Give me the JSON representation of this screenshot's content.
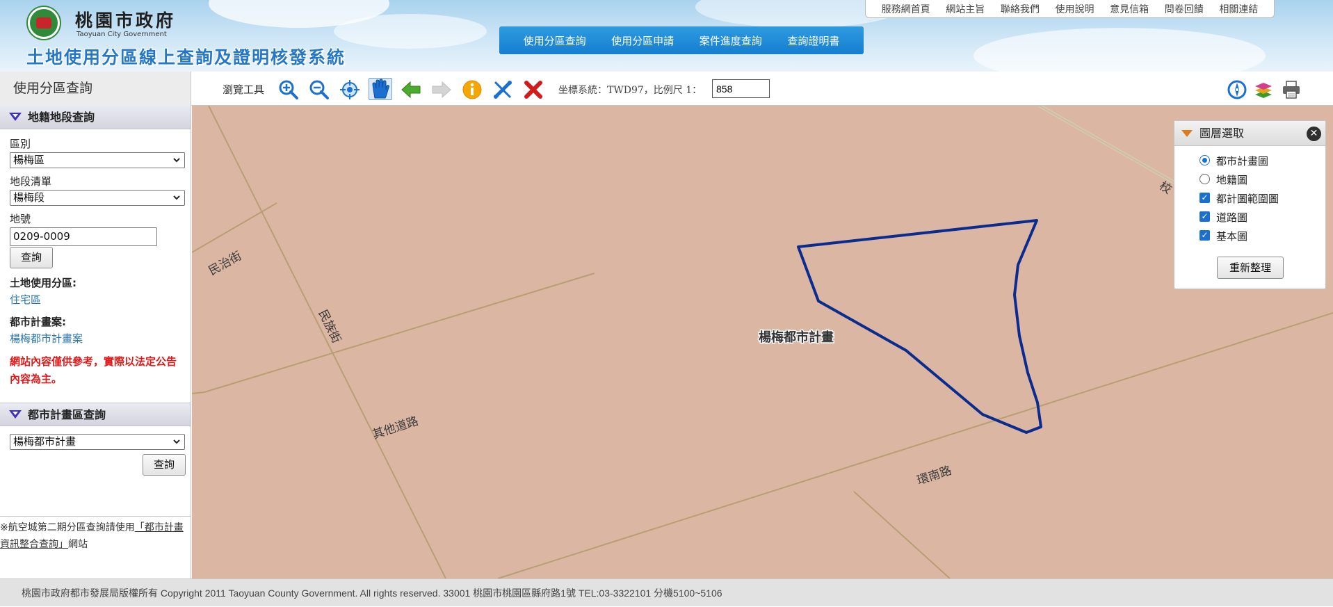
{
  "header": {
    "org_name": "桃園市政府",
    "org_name_en": "Taoyuan City Government",
    "system_title": "土地使用分區線上查詢及證明核發系統",
    "top_links": [
      "服務網首頁",
      "網站主旨",
      "聯絡我們",
      "使用說明",
      "意見信箱",
      "問卷回饋",
      "相關連結"
    ],
    "main_nav": [
      "使用分區查詢",
      "使用分區申請",
      "案件進度查詢",
      "查詢證明書"
    ]
  },
  "toolbar": {
    "panel_title": "使用分區查詢",
    "browse_label": "瀏覽工具",
    "tools": [
      "zoom-in-icon",
      "zoom-out-icon",
      "full-extent-icon",
      "pan-hand-icon",
      "previous-extent-icon",
      "next-extent-icon",
      "identify-info-icon",
      "measure-icon",
      "clear-icon"
    ],
    "coord_label": "坐標系統：TWD97，比例尺 1：",
    "scale_value": "858",
    "right_tools": [
      "compass-icon",
      "layers-icon",
      "print-icon"
    ]
  },
  "cadastral_query": {
    "section_title": "地籍地段查詢",
    "district_label": "區別",
    "district_value": "楊梅區",
    "section_list_label": "地段清單",
    "section_list_value": "楊梅段",
    "lot_label": "地號",
    "lot_value": "0209-0009",
    "query_button": "查詢",
    "zoning_label": "土地使用分區:",
    "zoning_value": "住宅區",
    "plan_label": "都市計畫案:",
    "plan_value": "楊梅都市計畫案",
    "disclaimer": "網站內容僅供參考，實際以法定公告內容為主。"
  },
  "urban_plan_query": {
    "section_title": "都市計畫區查詢",
    "plan_value": "楊梅都市計畫",
    "query_button": "查詢"
  },
  "aerotropolis_note": {
    "prefix": "※航空城第二期分區查詢請使用",
    "link": "「都市計畫資訊整合查詢」",
    "suffix": "網站"
  },
  "map": {
    "street_labels": [
      "民治街",
      "民族街",
      "其他道路",
      "環南路",
      "校"
    ],
    "plan_area_label": "楊梅都市計畫",
    "colors": {
      "background": "#dbb7a3",
      "road": "#b79f73",
      "parcel_outline": "#0b2c8f"
    }
  },
  "layer_panel": {
    "title": "圖層選取",
    "layers": [
      {
        "label": "都市計畫圖",
        "type": "radio",
        "checked": true
      },
      {
        "label": "地籍圖",
        "type": "radio",
        "checked": false
      },
      {
        "label": "都計圖範圍圖",
        "type": "checkbox",
        "checked": true
      },
      {
        "label": "道路圖",
        "type": "checkbox",
        "checked": true
      },
      {
        "label": "基本圖",
        "type": "checkbox",
        "checked": true
      }
    ],
    "refresh_button": "重新整理"
  },
  "footer": {
    "text": "桃園市政府都市發展局版權所有 Copyright 2011 Taoyuan County Government. All rights reserved. 33001 桃園市桃園區縣府路1號 TEL:03-3322101 分機5100~5106"
  }
}
